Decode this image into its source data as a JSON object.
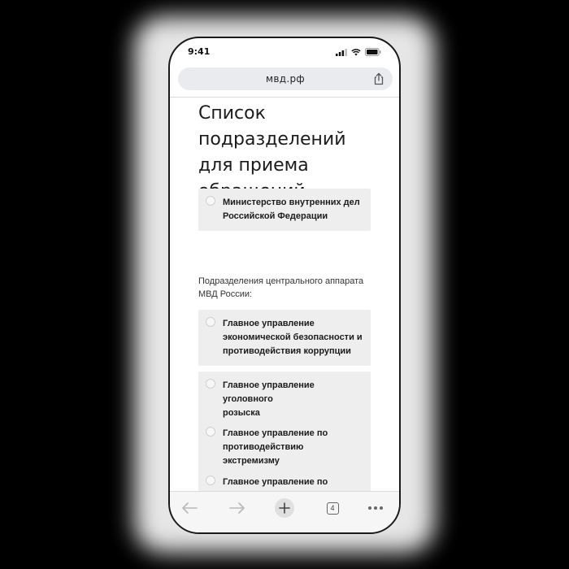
{
  "status_bar": {
    "time": "9:41"
  },
  "browser": {
    "url": "мвд.рф",
    "tabs_count": "4"
  },
  "page": {
    "title": "Список подразделений для приема обращений",
    "options_top": [
      {
        "label": "Министерство внутренних дел\nРоссийской Федерации"
      }
    ],
    "section_label": "Подразделения центрального аппарата\nМВД России:",
    "options": [
      {
        "label": "Главное управление\nэкономической безопасности и\nпротиводействия коррупции"
      },
      {
        "label": "Главное управление уголовного\nрозыска"
      },
      {
        "label": "Главное управление по\nпротиводействию экстремизму"
      },
      {
        "label": "Главное управление по\nобеспечению охраны\nобщественного порядка и\nкоординации взаимодействия с"
      }
    ]
  },
  "icons": {
    "back": "arrow-left-icon",
    "forward": "arrow-right-icon",
    "new_tab": "plus-icon",
    "tabs": "tabs-icon",
    "more": "more-dots-icon",
    "share": "share-icon",
    "signal": "signal-icon",
    "wifi": "wifi-icon",
    "battery": "battery-icon"
  }
}
